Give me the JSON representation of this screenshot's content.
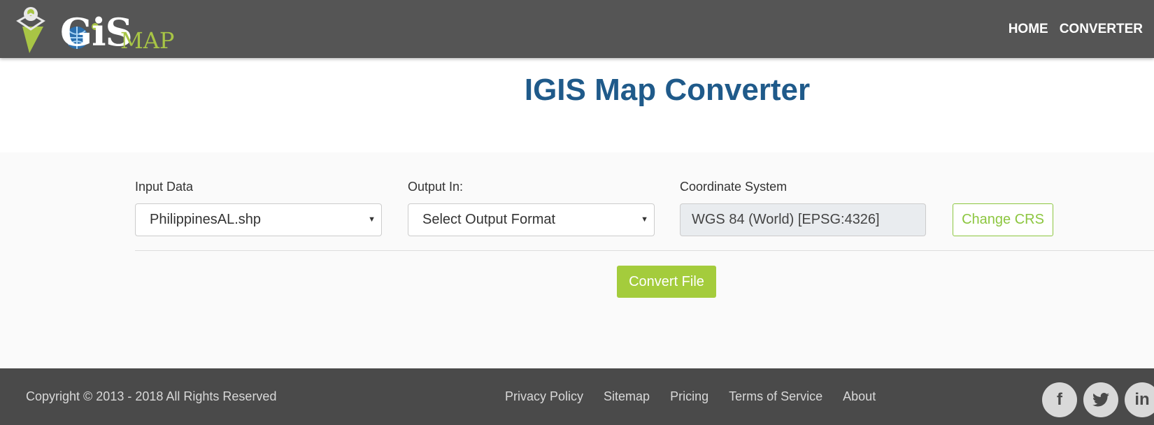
{
  "brand": {
    "logo_text": "GiS",
    "logo_sub": "MAP",
    "colors": {
      "header_bg": "#555555",
      "accent": "#a4cc3c",
      "title": "#1f5a8a",
      "footer_bg": "#4a4a4a"
    }
  },
  "nav": {
    "home": "HOME",
    "converter": "CONVERTER"
  },
  "page": {
    "title": "IGIS Map Converter"
  },
  "form": {
    "input_label": "Input Data",
    "input_value": "PhilippinesAL.shp",
    "output_label": "Output In:",
    "output_value": "Select Output Format",
    "crs_label": "Coordinate System",
    "crs_value": "WGS 84 (World) [EPSG:4326]",
    "change_crs": "Change CRS",
    "convert": "Convert File",
    "dropdown_icon": "caret-down-icon"
  },
  "footer": {
    "copyright": "Copyright © 2013 - 2018 All Rights Reserved",
    "links": [
      "Privacy Policy",
      "Sitemap",
      "Pricing",
      "Terms of Service",
      "About"
    ],
    "social": [
      {
        "icon": "facebook-icon",
        "glyph": "f"
      },
      {
        "icon": "twitter-icon",
        "glyph": "t"
      },
      {
        "icon": "linkedin-icon",
        "glyph": "in"
      }
    ]
  }
}
